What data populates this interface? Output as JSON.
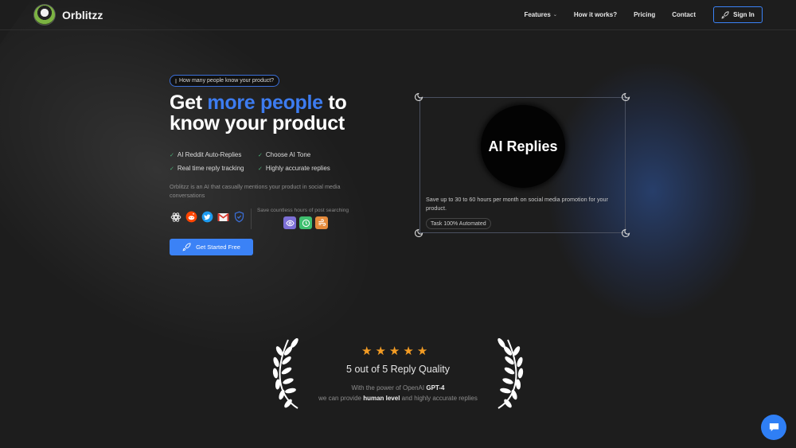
{
  "header": {
    "brand": "Orblitzz",
    "nav": [
      {
        "label": "Features",
        "has_dropdown": true
      },
      {
        "label": "How it works?"
      },
      {
        "label": "Pricing"
      },
      {
        "label": "Contact"
      }
    ],
    "signin_label": "Sign In"
  },
  "hero": {
    "badge": "How many people know your product?",
    "title_part1": "Get ",
    "title_accent": "more people",
    "title_part2": " to",
    "title_line2": "know your product",
    "features": [
      "AI Reddit Auto-Replies",
      "Choose AI Tone",
      "Real time reply tracking",
      "Highly accurate replies"
    ],
    "description": "Orblitzz is an AI that casually mentions your product in social media conversations",
    "integrations": [
      "openai-icon",
      "reddit-icon",
      "twitter-icon",
      "gmail-icon",
      "shield-check-icon"
    ],
    "save_text": "Save countless hours of post searching",
    "feature_icons": [
      {
        "name": "eye-icon",
        "color": "#7c6fd6"
      },
      {
        "name": "clock-icon",
        "color": "#3fbf6f"
      },
      {
        "name": "wind-icon",
        "color": "#e58b3c"
      }
    ],
    "cta_label": "Get Started Free"
  },
  "card": {
    "title": "AI Replies",
    "description": "Save up to 30 to 60 hours per month on social media promotion for your product.",
    "tag": "Task 100% Automated"
  },
  "rating": {
    "stars": 5,
    "max_stars": 5,
    "title": "5 out of 5 Reply Quality",
    "line1_prefix": "With the power of OpenAI ",
    "line1_bold": "GPT-4",
    "line2_prefix": "we can provide ",
    "line2_bold": "human level",
    "line2_suffix": " and highly accurate replies"
  },
  "colors": {
    "accent": "#3b82f6",
    "star": "#f39c24",
    "check": "#4caf76"
  }
}
